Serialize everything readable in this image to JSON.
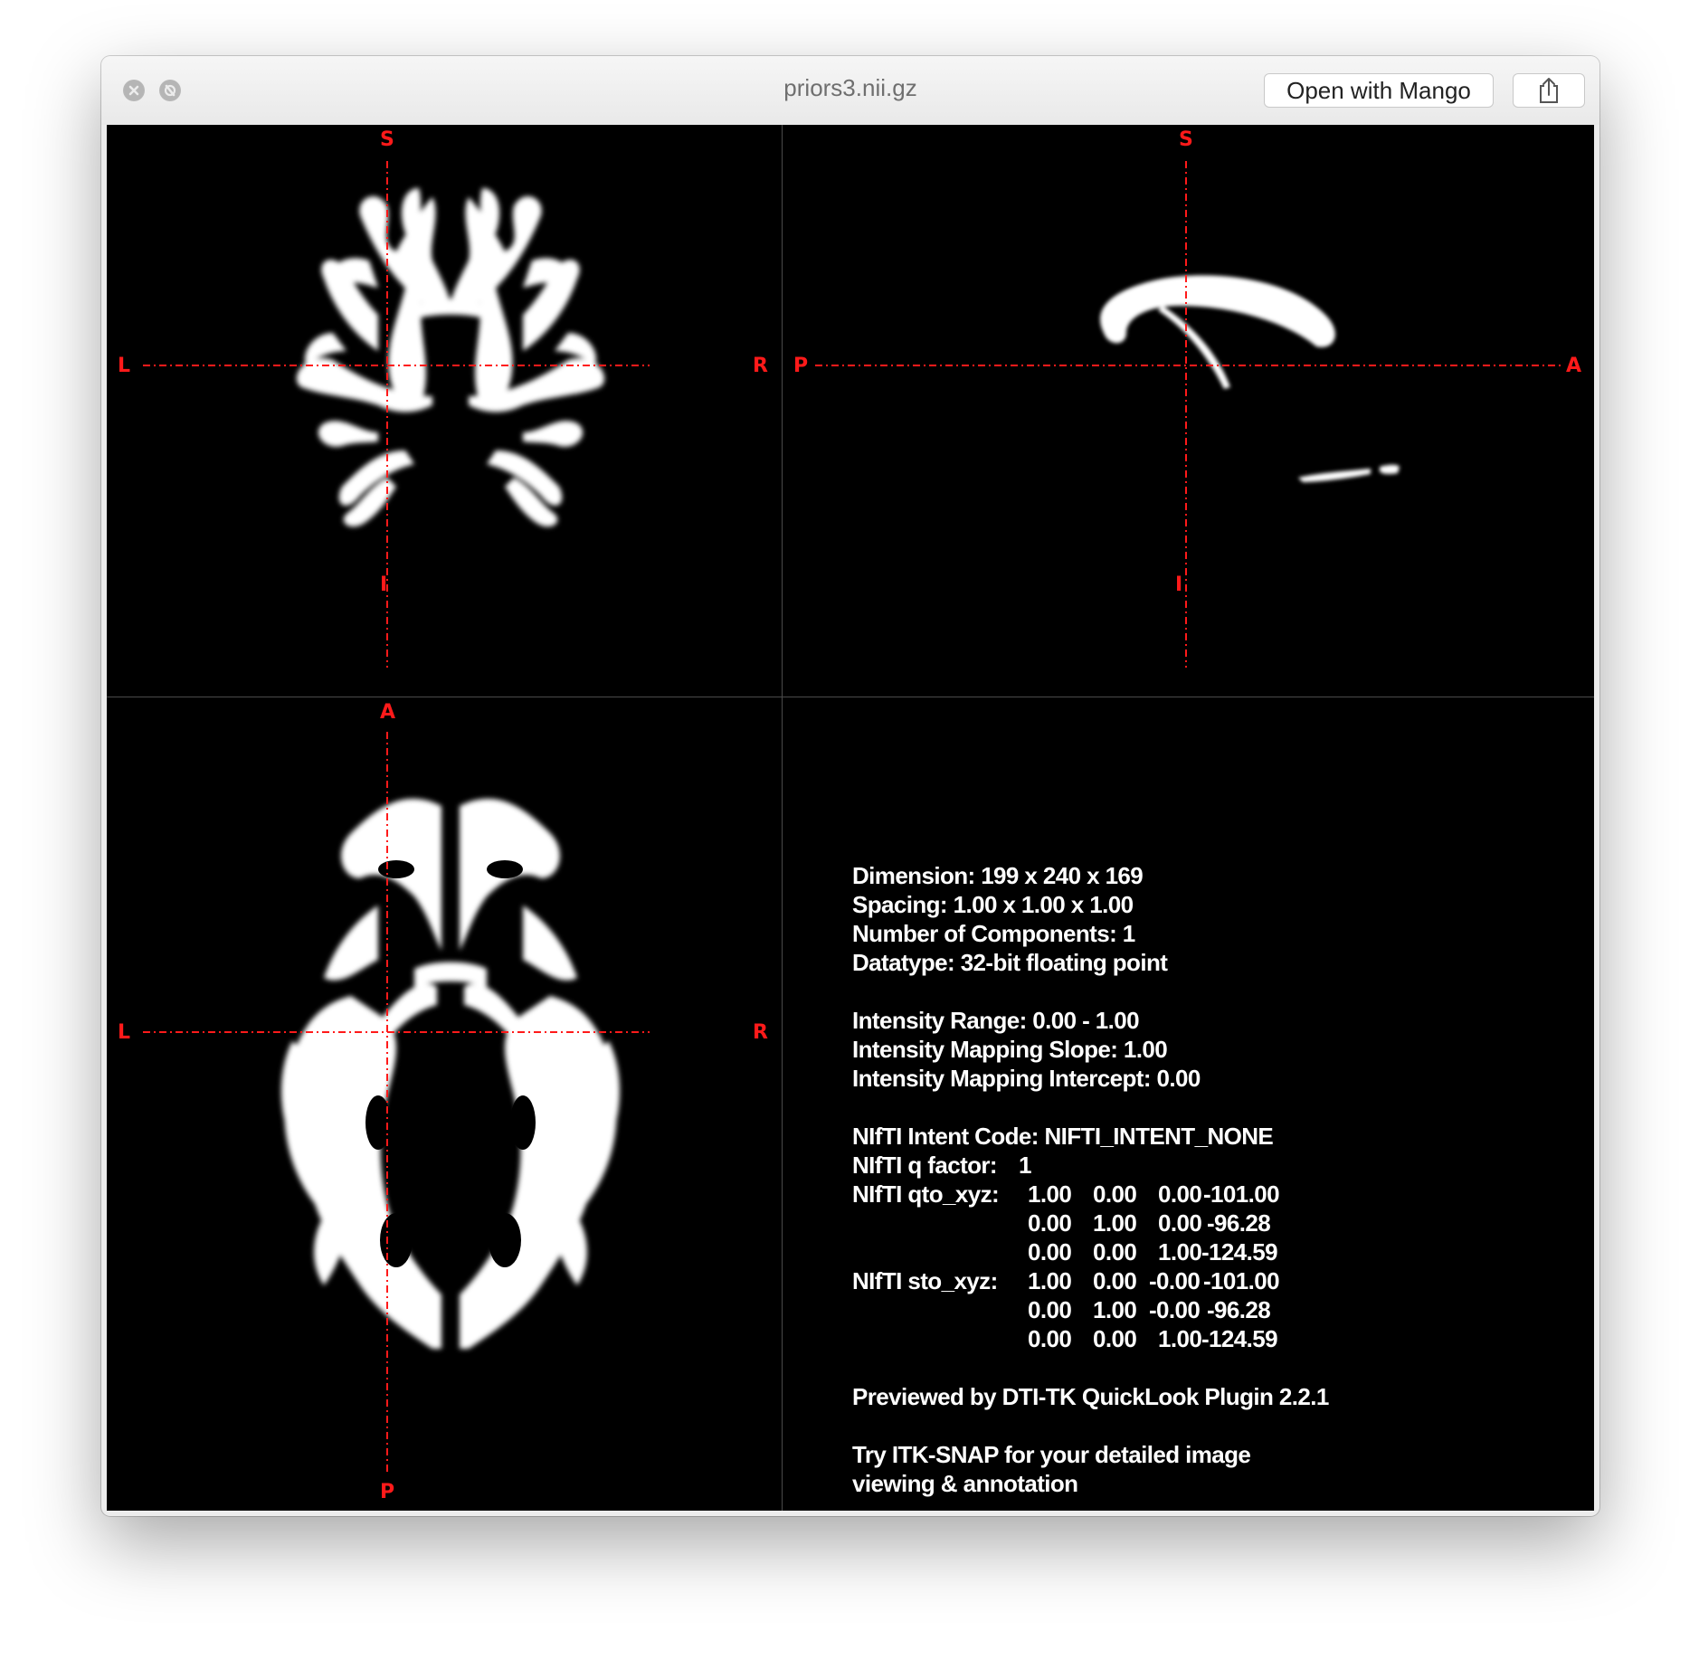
{
  "window": {
    "title": "priors3.nii.gz",
    "open_button_label": "Open with Mango",
    "close_icon": "close-icon",
    "fullscreen_icon": "fullscreen-icon",
    "share_icon": "share-icon"
  },
  "views": {
    "coronal": {
      "top": "S",
      "bottom": "I",
      "left": "L",
      "right": "R"
    },
    "sagittal": {
      "top": "S",
      "bottom": "I",
      "left": "P",
      "right": "A"
    },
    "axial": {
      "top": "A",
      "bottom": "P",
      "left": "L",
      "right": "R"
    },
    "crosshair_color": "#ff1a1a"
  },
  "info": {
    "dimension": "Dimension: 199 x 240 x 169",
    "spacing": "Spacing: 1.00 x 1.00 x 1.00",
    "components": "Number of Components: 1",
    "datatype": "Datatype: 32-bit floating point",
    "intensity_range": "Intensity Range: 0.00 - 1.00",
    "mapping_slope": "Intensity Mapping Slope: 1.00",
    "mapping_intercept": "Intensity Mapping Intercept: 0.00",
    "intent_code": "NIfTI Intent Code: NIFTI_INTENT_NONE",
    "q_factor_label": "NIfTI q factor:",
    "q_factor_value": "1",
    "qto_label": "NIfTI qto_xyz:",
    "qto_rows": [
      [
        "1.00",
        "0.00",
        "0.00",
        "-101.00"
      ],
      [
        "0.00",
        "1.00",
        "0.00",
        "-96.28"
      ],
      [
        "0.00",
        "0.00",
        "1.00",
        "-124.59"
      ]
    ],
    "sto_label": "NIfTI sto_xyz:",
    "sto_rows": [
      [
        "1.00",
        "0.00",
        "-0.00",
        "-101.00"
      ],
      [
        "0.00",
        "1.00",
        "-0.00",
        "-96.28"
      ],
      [
        "0.00",
        "0.00",
        "1.00",
        "-124.59"
      ]
    ],
    "previewed_by": "Previewed by DTI-TK QuickLook Plugin 2.2.1",
    "try_line1": "Try ITK-SNAP for your detailed image",
    "try_line2": "viewing & annotation"
  }
}
